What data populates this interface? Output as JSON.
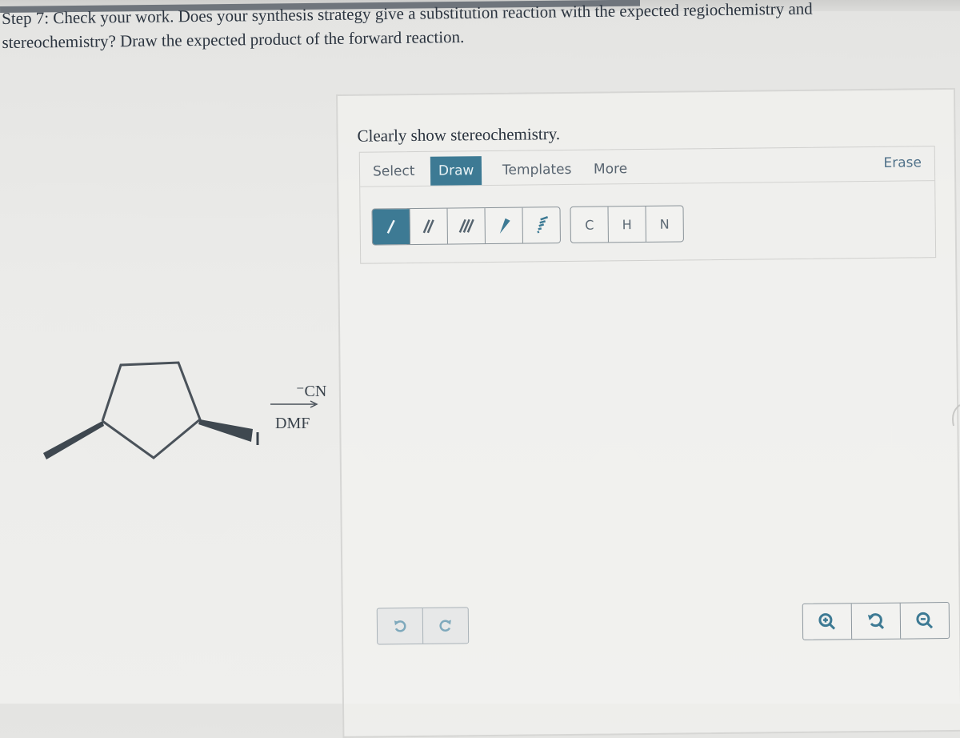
{
  "prompt": {
    "line1": "Step 7: Check your work. Does your synthesis strategy give a substitution reaction with the expected regiochemistry and",
    "line2": "stereochemistry? Draw the expected product of the forward reaction."
  },
  "reaction": {
    "substrate": "cis-1-iodo-3-methylcyclopentane (wedge methyl, wedge iodo)",
    "substituent_label": "I",
    "reagent_above_arrow": "⁻CN",
    "reagent_below_arrow": "DMF"
  },
  "editor": {
    "instructions": "Clearly show stereochemistry.",
    "tabs": [
      {
        "label": "Select",
        "active": false
      },
      {
        "label": "Draw",
        "active": true
      },
      {
        "label": "Templates",
        "active": false
      },
      {
        "label": "More",
        "active": false
      }
    ],
    "erase_label": "Erase",
    "bond_tools": [
      {
        "name": "single-bond",
        "active": true
      },
      {
        "name": "double-bond",
        "active": false
      },
      {
        "name": "triple-bond",
        "active": false
      },
      {
        "name": "wedge-bond",
        "active": false
      },
      {
        "name": "hash-bond",
        "active": false
      }
    ],
    "atoms": [
      "C",
      "H",
      "N"
    ],
    "history_tools": [
      "undo-icon",
      "redo-icon"
    ],
    "zoom_tools": [
      "zoom-in-icon",
      "reset-zoom-icon",
      "zoom-out-icon"
    ]
  },
  "colors": {
    "accent": "#3d7a94",
    "text": "#2c3540"
  }
}
